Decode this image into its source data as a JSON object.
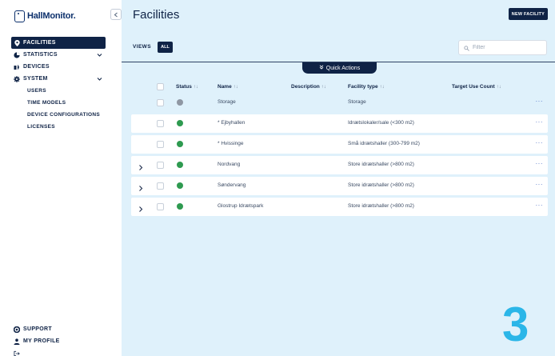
{
  "brand": {
    "name": "HallMonitor."
  },
  "sidebar": {
    "items": [
      {
        "label": "FACILITIES",
        "icon": "location-pin-icon",
        "active": true
      },
      {
        "label": "STATISTICS",
        "icon": "pie-chart-icon",
        "expandable": true
      },
      {
        "label": "DEVICES",
        "icon": "devices-icon"
      },
      {
        "label": "SYSTEM",
        "icon": "gear-icon",
        "expandable": true,
        "expanded": true
      }
    ],
    "system_sub": [
      "USERS",
      "TIME MODELS",
      "DEVICE CONFIGURATIONS",
      "LICENSES"
    ],
    "bottom": [
      {
        "label": "SUPPORT",
        "icon": "support-icon"
      },
      {
        "label": "MY PROFILE",
        "icon": "user-icon"
      }
    ]
  },
  "header": {
    "title": "Facilities",
    "new_button": "NEW FACILITY"
  },
  "views": {
    "label": "VIEWS",
    "active": "ALL"
  },
  "filter": {
    "placeholder": "Filter"
  },
  "quick_actions": {
    "label": "Quick Actions"
  },
  "table": {
    "columns": [
      "Status",
      "Name",
      "Description",
      "Facility type",
      "Target Use Count"
    ],
    "rows": [
      {
        "status": "idle",
        "name": "Storage",
        "description": "",
        "type": "Storage",
        "target": "",
        "expandable": false
      },
      {
        "status": "ok",
        "name": "* Ejbyhallen",
        "description": "",
        "type": "Idrætslokaler/sale (<300 m2)",
        "target": "",
        "expandable": false
      },
      {
        "status": "ok",
        "name": "* Hvissinge",
        "description": "",
        "type": "Små idrætshaller (300-799 m2)",
        "target": "",
        "expandable": false
      },
      {
        "status": "ok",
        "name": "Nordvang",
        "description": "",
        "type": "Store idrætshaller (>800 m2)",
        "target": "",
        "expandable": true
      },
      {
        "status": "ok",
        "name": "Søndervang",
        "description": "",
        "type": "Store idrætshaller (>800 m2)",
        "target": "",
        "expandable": true
      },
      {
        "status": "ok",
        "name": "Glostrup Idrætspark",
        "description": "",
        "type": "Store idrætshaller (>800 m2)",
        "target": "",
        "expandable": true
      }
    ],
    "row_menu": "···"
  },
  "watermark": "3",
  "colors": {
    "navy": "#0f2346",
    "panel": "#dff1fb",
    "success": "#2e9a50",
    "accent": "#2bb6e8"
  }
}
